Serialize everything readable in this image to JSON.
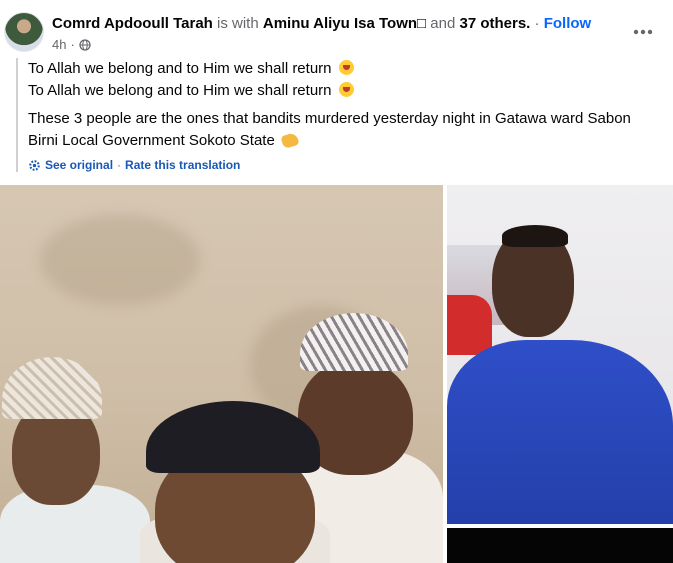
{
  "post": {
    "author": "Comrd Apdooull Tarah",
    "with_text": "is with",
    "tagged_person": "Aminu Aliyu Isa Town□",
    "and_text": "and",
    "others": "37 others.",
    "separator": "·",
    "follow_label": "Follow",
    "time": "4h",
    "time_separator": "·",
    "more_icon": "more-horizontal-icon",
    "privacy_icon": "globe-icon"
  },
  "translation": {
    "line1": "To Allah we belong and to Him we shall return",
    "line2": "To Allah we belong and to Him we shall return",
    "line3": "These 3 people are the ones that bandits murdered yesterday night in Gatawa ward Sabon Birni Local Government Sokoto State",
    "see_original": "See original",
    "separator": "·",
    "rate": "Rate this translation",
    "emoji_icon": "crying-face-emoji",
    "hand_icon": "pointing-hand-emoji",
    "settings_icon": "gear-icon"
  },
  "colors": {
    "link": "#1958b5",
    "follow": "#0866ff",
    "muted": "#65676b"
  }
}
